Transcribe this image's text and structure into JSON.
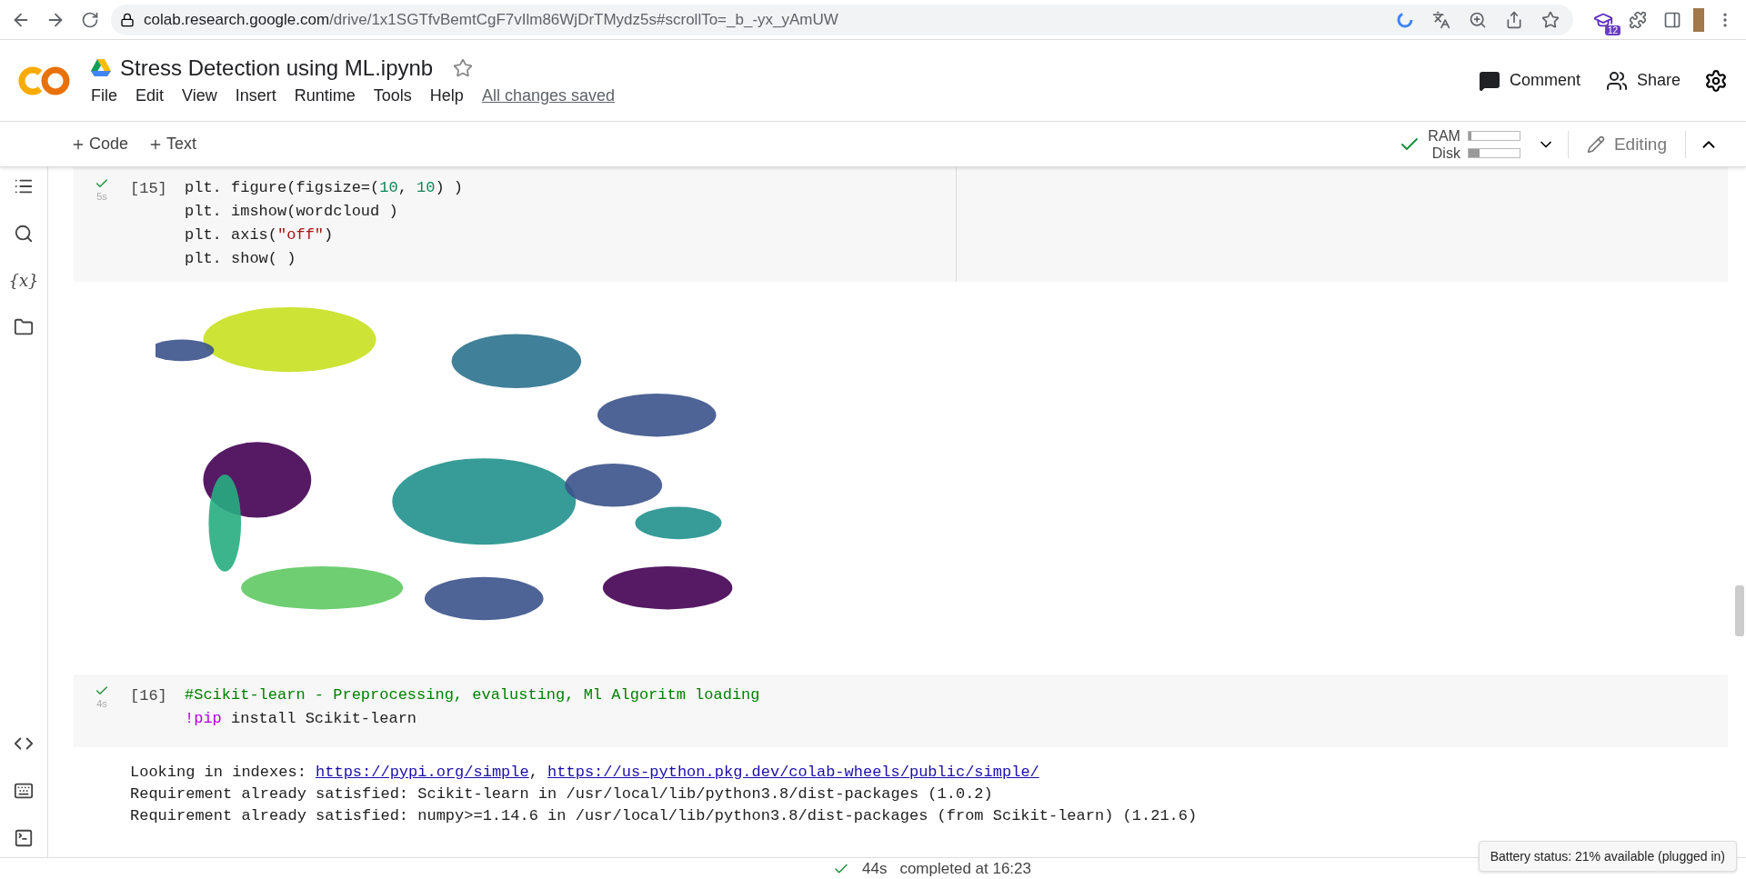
{
  "browser": {
    "url_host": "colab.research.google.com",
    "url_path": "/drive/1x1SGTfvBemtCgF7vIlm86WjDrTMydz5s#scrollTo=_b_-yx_yAmUW",
    "extension_badge": "12"
  },
  "notebook": {
    "title": "Stress Detection using ML.ipynb",
    "starred": false,
    "menu": [
      "File",
      "Edit",
      "View",
      "Insert",
      "Runtime",
      "Tools",
      "Help"
    ],
    "save_status": "All changes saved",
    "actions": [
      {
        "kind": "comment",
        "label": "Comment"
      },
      {
        "kind": "share",
        "label": "Share"
      }
    ]
  },
  "toolbar": {
    "add": [
      "Code",
      "Text"
    ],
    "resources": [
      {
        "label": "RAM",
        "level": 0.06
      },
      {
        "label": "Disk",
        "level": 0.22
      }
    ],
    "mode": "Editing"
  },
  "sidebar": {
    "variables_label": "{x}"
  },
  "cells": [
    {
      "number": "[15]",
      "duration": "5s",
      "done": true,
      "lines": [
        [
          {
            "t": "plt. figure(figsize=(",
            "kind": "code"
          },
          {
            "t": "10",
            "kind": "num"
          },
          {
            "t": ", ",
            "kind": "code"
          },
          {
            "t": "10",
            "kind": "num"
          },
          {
            "t": ") )",
            "kind": "code"
          }
        ],
        [
          {
            "t": "plt. imshow(wordcloud )",
            "kind": "code"
          }
        ],
        [
          {
            "t": "plt. axis(",
            "kind": "code"
          },
          {
            "t": "\"off\"",
            "kind": "str"
          },
          {
            "t": ")",
            "kind": "code"
          }
        ],
        [
          {
            "t": "plt. show( )",
            "kind": "code"
          }
        ]
      ],
      "output": {
        "kind": "picture"
      }
    },
    {
      "number": "[16]",
      "duration": "4s",
      "done": true,
      "lines": [
        [
          {
            "t": "#Scikit-learn - Preprocessing, evalusting, Ml Algoritm loading",
            "kind": "comment"
          }
        ],
        [
          {
            "t": "!pip",
            "kind": "magic"
          },
          {
            "t": " install Scikit-learn",
            "kind": "code"
          }
        ]
      ],
      "output": {
        "kind": "text",
        "lines": [
          [
            {
              "t": "Looking in indexes: ",
              "kind": "text"
            },
            {
              "t": "https://pypi.org/simple",
              "kind": "link"
            },
            {
              "t": ", ",
              "kind": "text"
            },
            {
              "t": "https://us-python.pkg.dev/colab-wheels/public/simple/",
              "kind": "link"
            }
          ],
          [
            {
              "t": "Requirement already satisfied: Scikit-learn in /usr/local/lib/python3.8/dist-packages (1.0.2)",
              "kind": "text"
            }
          ],
          [
            {
              "t": "Requirement already satisfied: numpy>=1.14.6 in /usr/local/lib/python3.8/dist-packages (from Scikit-learn) (1.21.6)",
              "kind": "text"
            }
          ]
        ]
      }
    }
  ],
  "status_bar": {
    "ok": true,
    "elapsed": "44s",
    "completed": "completed at 16:23"
  },
  "tooltip": "Battery status: 21% available (plugged in)"
}
